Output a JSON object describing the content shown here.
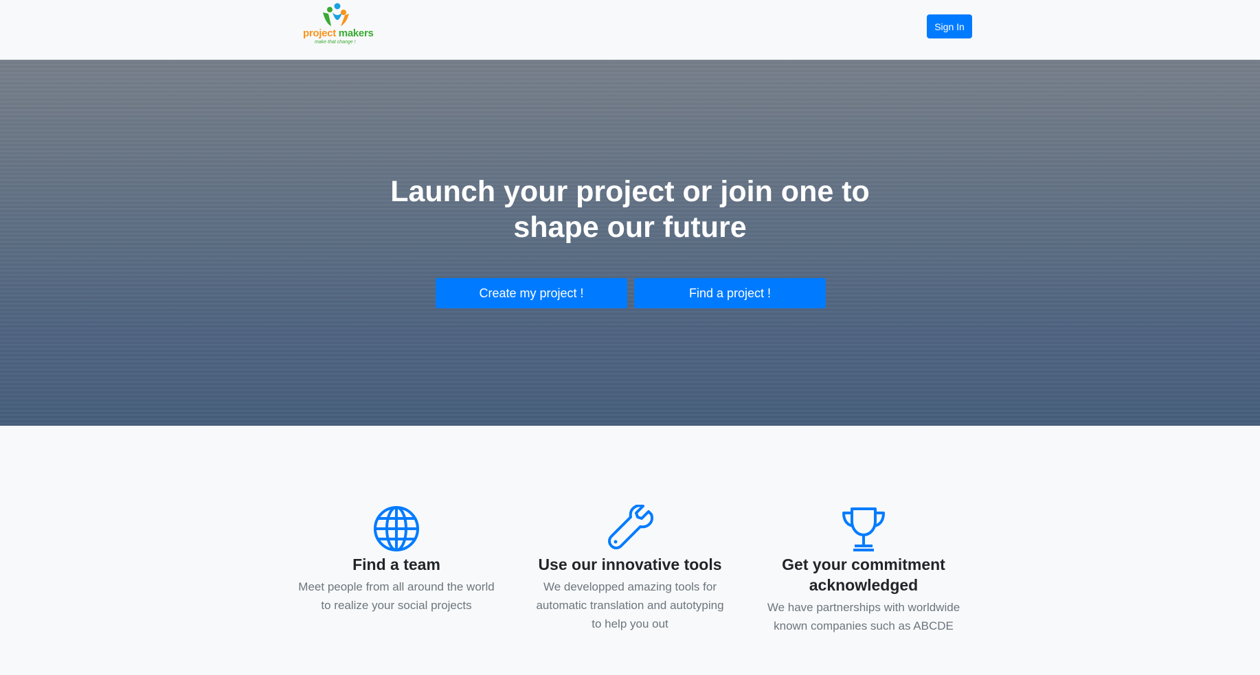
{
  "navbar": {
    "logo": {
      "word_part1": "project",
      "word_part2": " makers",
      "tagline": "make that change !"
    },
    "signin_label": "Sign In"
  },
  "hero": {
    "title": "Launch your project or join one to shape our future",
    "create_button": "Create my project !",
    "find_button": "Find a project !"
  },
  "features": [
    {
      "icon": "globe-icon",
      "title": "Find a team",
      "text": "Meet people from all around the world to realize your social projects"
    },
    {
      "icon": "wrench-icon",
      "title": "Use our innovative tools",
      "text": "We developped amazing tools for automatic translation and autotyping to help you out"
    },
    {
      "icon": "trophy-icon",
      "title": "Get your commitment acknowledged",
      "text": "We have partnerships with worldwide known companies such as ABCDE"
    }
  ],
  "colors": {
    "primary": "#007bff",
    "background": "#f8f9fa",
    "logo_orange": "#f7941d",
    "logo_green": "#3aaa35",
    "logo_blue": "#1ba1e2"
  }
}
